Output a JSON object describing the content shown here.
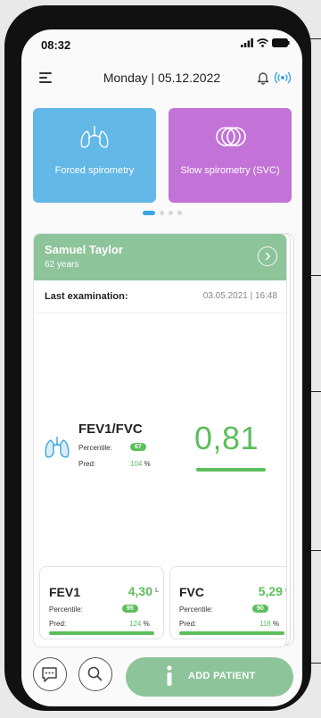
{
  "status_bar": {
    "time": "08:32"
  },
  "header": {
    "date": "Monday | 05.12.2022"
  },
  "modes": [
    {
      "label": "Forced spirometry",
      "color": "#63b8e7"
    },
    {
      "label": "Slow spirometry (SVC)",
      "color": "#c373d8"
    }
  ],
  "carousel": {
    "page": 1,
    "pages": 4
  },
  "patient": {
    "name": "Samuel Taylor",
    "age": "62 years",
    "last_exam_label": "Last examination:",
    "last_exam_date": "03.05.2021 | 16:48"
  },
  "ratio": {
    "title": "FEV1/FVC",
    "percentile_label": "Percentile:",
    "percentile": "67",
    "pred_label": "Pred:",
    "pred": "104",
    "pred_unit": "%",
    "value": "0,81"
  },
  "metrics": [
    {
      "title": "FEV1",
      "value": "4,30",
      "unit": "L",
      "percentile_label": "Percentile:",
      "percentile": "95",
      "pred_label": "Pred:",
      "pred": "124",
      "pred_unit": "%"
    },
    {
      "title": "FVC",
      "value": "5,29",
      "unit": "L",
      "percentile_label": "Percentile:",
      "percentile": "90",
      "pred_label": "Pred:",
      "pred": "118",
      "pred_unit": "%"
    }
  ],
  "actions": {
    "add_patient": "ADD PATIENT"
  },
  "colors": {
    "accent_green": "#5cbe5c",
    "header_green": "#8dc49a",
    "blue": "#3aa6e0"
  }
}
